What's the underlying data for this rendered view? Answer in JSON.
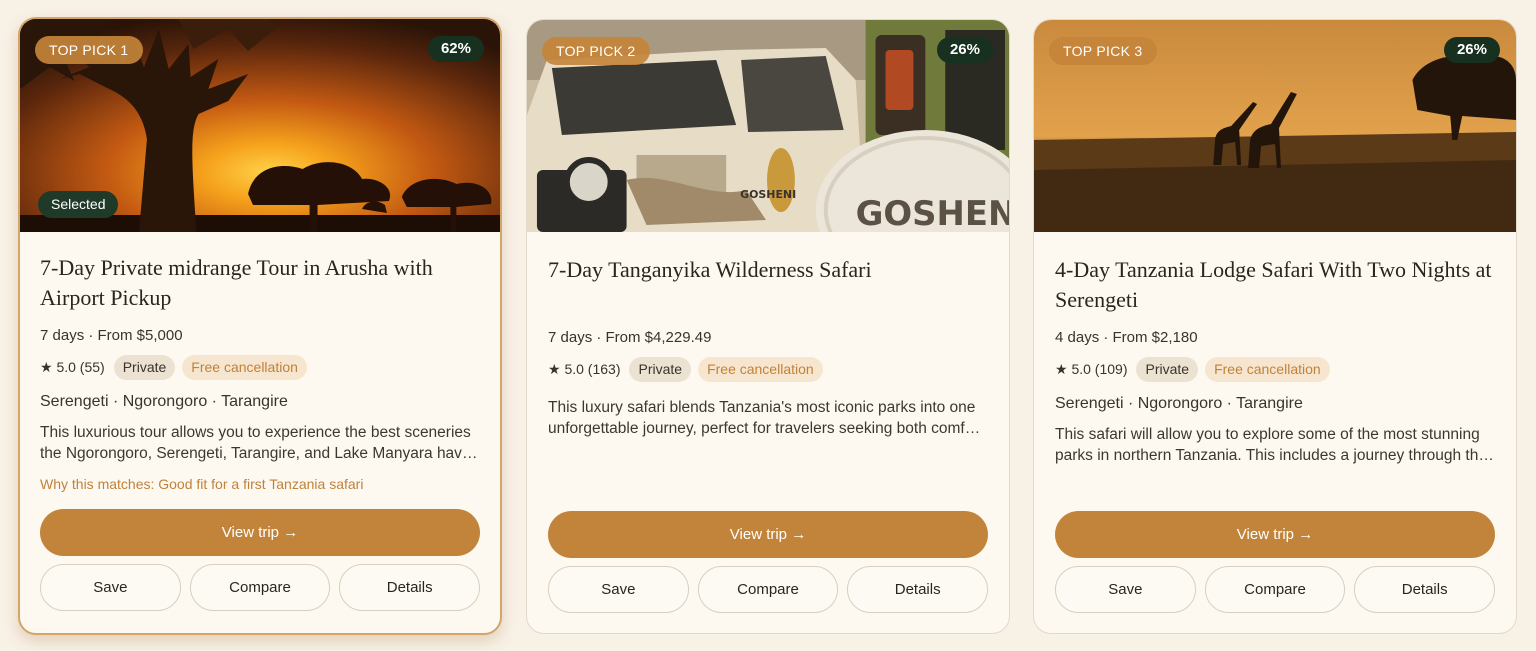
{
  "cards": [
    {
      "pick_label": "TOP PICK 1",
      "match_pct": "62%",
      "selected_label": "Selected",
      "title": "7-Day Private midrange Tour in Arusha with Airport Pickup",
      "meta": "7 days · From $5,000",
      "rating": "★ 5.0 (55)",
      "tag_private": "Private",
      "tag_free": "Free cancellation",
      "parks": "Serengeti · Ngorongoro · Tarangire",
      "description": "This luxurious tour allows you to experience the best sceneries the Ngorongoro, Serengeti, Tarangire, and Lake Manyara have to offer.",
      "why": "Why this matches: Good fit for a first Tanzania safari",
      "view_label": "View trip →",
      "save_label": "Save",
      "compare_label": "Compare",
      "details_label": "Details",
      "image_icon": "baobab-sunset-image"
    },
    {
      "pick_label": "TOP PICK 2",
      "match_pct": "26%",
      "title": "7-Day Tanganyika Wilderness Safari",
      "meta": "7 days · From $4,229.49",
      "rating": "★ 5.0 (163)",
      "tag_private": "Private",
      "tag_free": "Free cancellation",
      "description": "This luxury safari blends Tanzania's most iconic parks into one unforgettable journey, perfect for travelers seeking both comfort and adventure.",
      "view_label": "View trip →",
      "save_label": "Save",
      "compare_label": "Compare",
      "details_label": "Details",
      "spare_wheel_text": "GOSHENI",
      "image_icon": "safari-vehicle-image"
    },
    {
      "pick_label": "TOP PICK 3",
      "match_pct": "26%",
      "title": "4-Day Tanzania Lodge Safari With Two Nights at Serengeti",
      "meta": "4 days · From $2,180",
      "rating": "★ 5.0 (109)",
      "tag_private": "Private",
      "tag_free": "Free cancellation",
      "parks": "Serengeti · Ngorongoro · Tarangire",
      "description": "This safari will allow you to explore some of the most stunning parks in northern Tanzania. This includes a journey through the Serengeti.",
      "view_label": "View trip →",
      "save_label": "Save",
      "compare_label": "Compare",
      "details_label": "Details",
      "image_icon": "giraffes-savanna-image"
    }
  ],
  "colors": {
    "accent": "#c1843a",
    "match_badge": "#17301f",
    "page_bg": "#f8f1e6",
    "card_bg": "#fdf9f1"
  }
}
